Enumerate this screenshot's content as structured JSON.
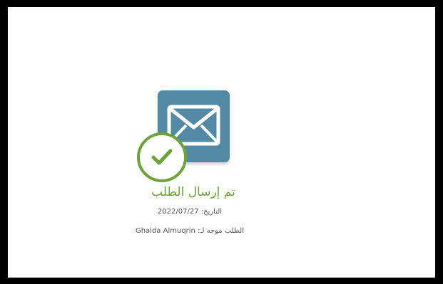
{
  "confirmation": {
    "title": "تم إرسال الطلب",
    "date_label": "التاريخ:",
    "date_value": "2022/07/27",
    "recipient_label": "الطلب موجه لـ:",
    "recipient_name": "Ghaida Almuqrin"
  },
  "icons": {
    "envelope": "envelope-icon",
    "check": "check-circle-icon"
  },
  "colors": {
    "envelope_bg": "#5489a6",
    "success": "#6ea339",
    "text": "#555555",
    "frame": "#000000"
  }
}
